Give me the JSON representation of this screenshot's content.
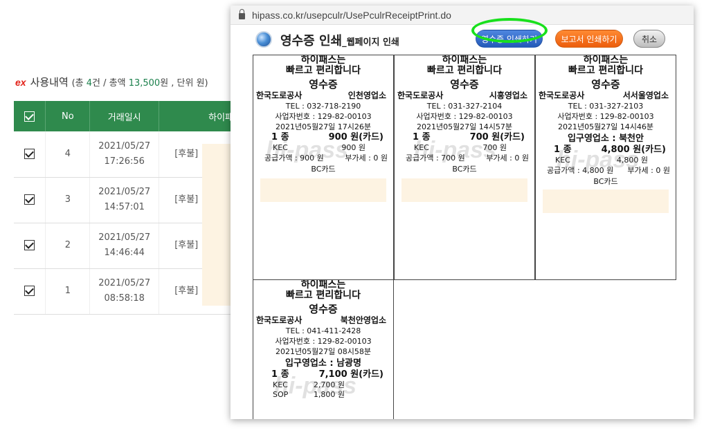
{
  "background": {
    "logo_text": "ex",
    "heading": "사용내역",
    "summary_prefix": "(총 ",
    "count": "4",
    "summary_mid": "건 / 총액 ",
    "total": "13,500",
    "summary_suffix": "원 , 단위 원)",
    "columns": [
      "No",
      "거래일시",
      "하이패"
    ],
    "rows": [
      {
        "no": "4",
        "date": "2021/05/27",
        "time": "17:26:56",
        "type": "[후불]"
      },
      {
        "no": "3",
        "date": "2021/05/27",
        "time": "14:57:01",
        "type": "[후불]"
      },
      {
        "no": "2",
        "date": "2021/05/27",
        "time": "14:46:44",
        "type": "[후불]"
      },
      {
        "no": "1",
        "date": "2021/05/27",
        "time": "08:58:18",
        "type": "[후불]"
      }
    ]
  },
  "popup": {
    "url": "hipass.co.kr/usepculr/UsePculrReceiptPrint.do",
    "title": "영수증 인쇄",
    "title_suffix": "_웹페이지 인쇄",
    "btn_print_receipt": "영수증 인쇄하기",
    "btn_print_report": "보고서 인쇄하기",
    "btn_cancel": "취소",
    "watermark": "hi-pass",
    "receipts": [
      {
        "head1": "하이패스는",
        "head2": "빠르고 편리합니다",
        "title": "영수증",
        "org": "한국도로공사",
        "office": "인천영업소",
        "tel": "TEL : 032-718-2190",
        "bizno": "사업자번호 : 129-82-00103",
        "datetime": "2021년05월27일 17시26분",
        "class": "1 종",
        "amount": "900 원(카드)",
        "kv": [
          {
            "k": "KEC",
            "v": "900 원"
          }
        ],
        "supply": "공급가액 : 900 원",
        "vat": "부가세 : 0 원",
        "card": "BC카드"
      },
      {
        "head1": "하이패스는",
        "head2": "빠르고 편리합니다",
        "title": "영수증",
        "org": "한국도로공사",
        "office": "시흥영업소",
        "tel": "TEL : 031-327-2104",
        "bizno": "사업자번호 : 129-82-00103",
        "datetime": "2021년05월27일 14시57분",
        "class": "1 종",
        "amount": "700 원(카드)",
        "kv": [
          {
            "k": "KEC",
            "v": "700 원"
          }
        ],
        "supply": "공급가액 : 700 원",
        "vat": "부가세 : 0 원",
        "card": "BC카드"
      },
      {
        "head1": "하이패스는",
        "head2": "빠르고 편리합니다",
        "title": "영수증",
        "org": "한국도로공사",
        "office": "서서울영업소",
        "tel": "TEL : 031-327-2103",
        "bizno": "사업자번호 : 129-82-00103",
        "datetime": "2021년05월27일 14시46분",
        "entry": "입구영업소 : 북천안",
        "class": "1 종",
        "amount": "4,800 원(카드)",
        "kv": [
          {
            "k": "KEC",
            "v": "4,800 원"
          }
        ],
        "supply": "공급가액 : 4,800 원",
        "vat": "부가세 : 0 원",
        "card": "BC카드"
      },
      {
        "head1": "하이패스는",
        "head2": "빠르고 편리합니다",
        "title": "영수증",
        "org": "한국도로공사",
        "office": "북천안영업소",
        "tel": "TEL : 041-411-2428",
        "bizno": "사업자번호 : 129-82-00103",
        "datetime": "2021년05월27일 08시58분",
        "entry": "입구영업소 : 남광명",
        "class": "1 종",
        "amount": "7,100 원(카드)",
        "kv": [
          {
            "k": "KEC",
            "v": "2,700 원"
          },
          {
            "k": "SOP",
            "v": "1,800 원"
          }
        ]
      }
    ]
  }
}
